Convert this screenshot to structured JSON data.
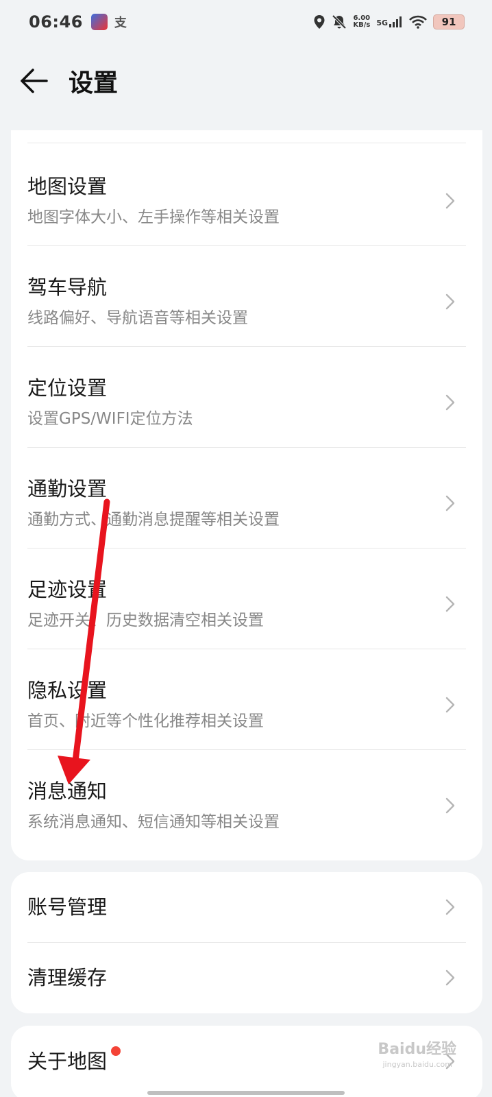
{
  "status_bar": {
    "time": "06:46",
    "netspeed_value": "6.00",
    "netspeed_unit": "KB/s",
    "signal_label": "5G",
    "battery": "91"
  },
  "header": {
    "title": "设置"
  },
  "settings_main": [
    {
      "title": "地图设置",
      "subtitle": "地图字体大小、左手操作等相关设置"
    },
    {
      "title": "驾车导航",
      "subtitle": "线路偏好、导航语音等相关设置"
    },
    {
      "title": "定位设置",
      "subtitle": "设置GPS/WIFI定位方法"
    },
    {
      "title": "通勤设置",
      "subtitle": "通勤方式、通勤消息提醒等相关设置"
    },
    {
      "title": "足迹设置",
      "subtitle": "足迹开关、历史数据清空相关设置"
    },
    {
      "title": "隐私设置",
      "subtitle": "首页、附近等个性化推荐相关设置"
    },
    {
      "title": "消息通知",
      "subtitle": "系统消息通知、短信通知等相关设置"
    }
  ],
  "settings_account": [
    {
      "title": "账号管理"
    },
    {
      "title": "清理缓存"
    }
  ],
  "settings_about": [
    {
      "title": "关于地图"
    }
  ],
  "watermark": {
    "main": "Baidu经验",
    "sub": "jingyan.baidu.com"
  },
  "colors": {
    "background": "#f1f3f5",
    "card": "#ffffff",
    "arrow": "#e8141e",
    "badge": "#f44336"
  }
}
